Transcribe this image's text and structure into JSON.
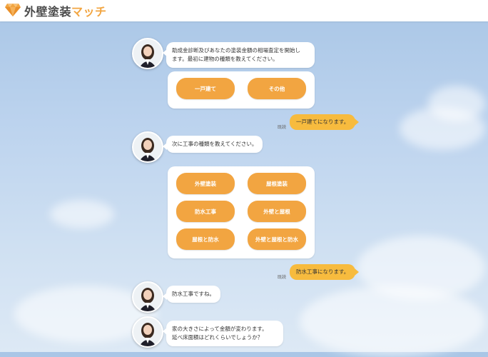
{
  "brand": {
    "name_main": "外壁塗装",
    "name_accent": "マッチ",
    "accent_color": "#f2a541",
    "logo_icon": "diamond-icon"
  },
  "chat": {
    "assistant_avatar": "operator-avatar",
    "messages": [
      {
        "role": "bot",
        "lines": [
          "助成金診断及びあなたの塗装金額の相場査定を開始し",
          "ます。最初に建物の種類を教えてください。"
        ]
      },
      {
        "role": "options",
        "items": [
          "一戸建て",
          "その他"
        ]
      },
      {
        "role": "user",
        "text": "一戸建てになります。",
        "read_label": "既読"
      },
      {
        "role": "bot",
        "lines": [
          "次に工事の種類を教えてください。"
        ]
      },
      {
        "role": "options",
        "items": [
          "外壁塗装",
          "屋根塗装",
          "防水工事",
          "外壁と屋根",
          "屋根と防水",
          "外壁と屋根と防水"
        ]
      },
      {
        "role": "user",
        "text": "防水工事になります。",
        "read_label": "既読"
      },
      {
        "role": "bot",
        "lines": [
          "防水工事ですね。"
        ]
      },
      {
        "role": "bot",
        "lines": [
          "家の大きさによって金額が変わります。",
          "延べ床面積はどれくらいでしょうか？"
        ]
      }
    ]
  }
}
